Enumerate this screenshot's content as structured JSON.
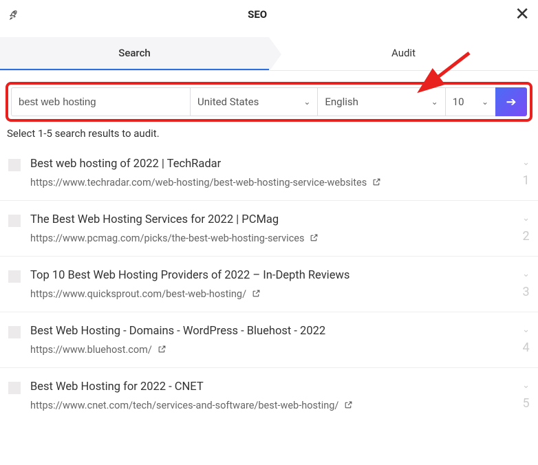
{
  "header": {
    "title": "SEO"
  },
  "tabs": [
    {
      "label": "Search",
      "active": true
    },
    {
      "label": "Audit",
      "active": false
    }
  ],
  "search": {
    "query": "best web hosting",
    "country": "United States",
    "language": "English",
    "count": "10"
  },
  "instruction": "Select 1-5 search results to audit.",
  "results": [
    {
      "title": "Best web hosting of 2022 | TechRadar",
      "url": "https://www.techradar.com/web-hosting/best-web-hosting-service-websites",
      "num": "1"
    },
    {
      "title": "The Best Web Hosting Services for 2022 | PCMag",
      "url": "https://www.pcmag.com/picks/the-best-web-hosting-services",
      "num": "2"
    },
    {
      "title": "Top 10 Best Web Hosting Providers of 2022 – In-Depth Reviews",
      "url": "https://www.quicksprout.com/best-web-hosting/",
      "num": "3"
    },
    {
      "title": "Best Web Hosting - Domains - WordPress - Bluehost - 2022",
      "url": "https://www.bluehost.com/",
      "num": "4"
    },
    {
      "title": "Best Web Hosting for 2022 - CNET",
      "url": "https://www.cnet.com/tech/services-and-software/best-web-hosting/",
      "num": "5"
    }
  ]
}
